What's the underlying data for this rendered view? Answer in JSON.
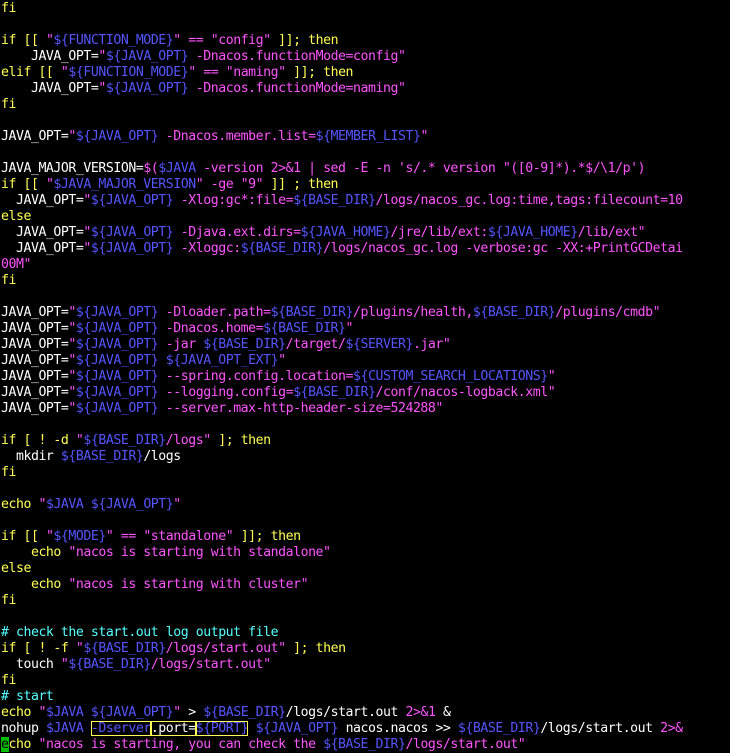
{
  "app": {
    "type": "terminal-vim",
    "theme": "dark"
  },
  "colors": {
    "background": "#000000",
    "text": "#ffffff",
    "keyword": "#ffff55",
    "string": "#ff55ff",
    "variable": "#5555ff",
    "comment": "#55ffff",
    "cursor": "#00c000"
  },
  "lines": [
    [
      {
        "t": "fi",
        "c": "k"
      }
    ],
    [],
    [
      {
        "t": "if [[ ",
        "c": "k"
      },
      {
        "t": "\"",
        "c": "s"
      },
      {
        "t": "${FUNCTION_MODE}",
        "c": "v"
      },
      {
        "t": "\" == \"config\"",
        "c": "s"
      },
      {
        "t": " ]]; then",
        "c": "k"
      }
    ],
    [
      {
        "t": "    JAVA_OPT=",
        "c": "w"
      },
      {
        "t": "\"",
        "c": "s"
      },
      {
        "t": "${JAVA_OPT}",
        "c": "v"
      },
      {
        "t": " -Dnacos.functionMode=config\"",
        "c": "s"
      }
    ],
    [
      {
        "t": "elif [[ ",
        "c": "k"
      },
      {
        "t": "\"",
        "c": "s"
      },
      {
        "t": "${FUNCTION_MODE}",
        "c": "v"
      },
      {
        "t": "\" == \"naming\"",
        "c": "s"
      },
      {
        "t": " ]]; then",
        "c": "k"
      }
    ],
    [
      {
        "t": "    JAVA_OPT=",
        "c": "w"
      },
      {
        "t": "\"",
        "c": "s"
      },
      {
        "t": "${JAVA_OPT}",
        "c": "v"
      },
      {
        "t": " -Dnacos.functionMode=naming\"",
        "c": "s"
      }
    ],
    [
      {
        "t": "fi",
        "c": "k"
      }
    ],
    [],
    [
      {
        "t": "JAVA_OPT=",
        "c": "w"
      },
      {
        "t": "\"",
        "c": "s"
      },
      {
        "t": "${JAVA_OPT}",
        "c": "v"
      },
      {
        "t": " -Dnacos.member.list=",
        "c": "s"
      },
      {
        "t": "${MEMBER_LIST}",
        "c": "v"
      },
      {
        "t": "\"",
        "c": "s"
      }
    ],
    [],
    [
      {
        "t": "JAVA_MAJOR_VERSION=",
        "c": "w"
      },
      {
        "t": "$(",
        "c": "s"
      },
      {
        "t": "$JAVA",
        "c": "v"
      },
      {
        "t": " -version 2>&1 | sed -E -n 's/.* version \"([0-9]*).*$/\\1/p')",
        "c": "s"
      }
    ],
    [
      {
        "t": "if [[ ",
        "c": "k"
      },
      {
        "t": "\"",
        "c": "s"
      },
      {
        "t": "$JAVA_MAJOR_VERSION",
        "c": "v"
      },
      {
        "t": "\" -ge \"9\"",
        "c": "s"
      },
      {
        "t": " ]] ; then",
        "c": "k"
      }
    ],
    [
      {
        "t": "  JAVA_OPT=",
        "c": "w"
      },
      {
        "t": "\"",
        "c": "s"
      },
      {
        "t": "${JAVA_OPT}",
        "c": "v"
      },
      {
        "t": " -Xlog:gc*:file=",
        "c": "s"
      },
      {
        "t": "${BASE_DIR}",
        "c": "v"
      },
      {
        "t": "/logs/nacos_gc.log:time,tags:filecount=10",
        "c": "s"
      }
    ],
    [
      {
        "t": "else",
        "c": "k"
      }
    ],
    [
      {
        "t": "  JAVA_OPT=",
        "c": "w"
      },
      {
        "t": "\"",
        "c": "s"
      },
      {
        "t": "${JAVA_OPT}",
        "c": "v"
      },
      {
        "t": " -Djava.ext.dirs=",
        "c": "s"
      },
      {
        "t": "${JAVA_HOME}",
        "c": "v"
      },
      {
        "t": "/jre/lib/ext:",
        "c": "s"
      },
      {
        "t": "${JAVA_HOME}",
        "c": "v"
      },
      {
        "t": "/lib/ext\"",
        "c": "s"
      }
    ],
    [
      {
        "t": "  JAVA_OPT=",
        "c": "w"
      },
      {
        "t": "\"",
        "c": "s"
      },
      {
        "t": "${JAVA_OPT}",
        "c": "v"
      },
      {
        "t": " -Xloggc:",
        "c": "s"
      },
      {
        "t": "${BASE_DIR}",
        "c": "v"
      },
      {
        "t": "/logs/nacos_gc.log -verbose:gc -XX:+PrintGCDetai",
        "c": "s"
      }
    ],
    [
      {
        "t": "00M\"",
        "c": "s"
      }
    ],
    [
      {
        "t": "fi",
        "c": "k"
      }
    ],
    [],
    [
      {
        "t": "JAVA_OPT=",
        "c": "w"
      },
      {
        "t": "\"",
        "c": "s"
      },
      {
        "t": "${JAVA_OPT}",
        "c": "v"
      },
      {
        "t": " -Dloader.path=",
        "c": "s"
      },
      {
        "t": "${BASE_DIR}",
        "c": "v"
      },
      {
        "t": "/plugins/health,",
        "c": "s"
      },
      {
        "t": "${BASE_DIR}",
        "c": "v"
      },
      {
        "t": "/plugins/cmdb\"",
        "c": "s"
      }
    ],
    [
      {
        "t": "JAVA_OPT=",
        "c": "w"
      },
      {
        "t": "\"",
        "c": "s"
      },
      {
        "t": "${JAVA_OPT}",
        "c": "v"
      },
      {
        "t": " -Dnacos.home=",
        "c": "s"
      },
      {
        "t": "${BASE_DIR}",
        "c": "v"
      },
      {
        "t": "\"",
        "c": "s"
      }
    ],
    [
      {
        "t": "JAVA_OPT=",
        "c": "w"
      },
      {
        "t": "\"",
        "c": "s"
      },
      {
        "t": "${JAVA_OPT}",
        "c": "v"
      },
      {
        "t": " -jar ",
        "c": "s"
      },
      {
        "t": "${BASE_DIR}",
        "c": "v"
      },
      {
        "t": "/target/",
        "c": "s"
      },
      {
        "t": "${SERVER}",
        "c": "v"
      },
      {
        "t": ".jar\"",
        "c": "s"
      }
    ],
    [
      {
        "t": "JAVA_OPT=",
        "c": "w"
      },
      {
        "t": "\"",
        "c": "s"
      },
      {
        "t": "${JAVA_OPT}",
        "c": "v"
      },
      {
        "t": " ",
        "c": "s"
      },
      {
        "t": "${JAVA_OPT_EXT}",
        "c": "v"
      },
      {
        "t": "\"",
        "c": "s"
      }
    ],
    [
      {
        "t": "JAVA_OPT=",
        "c": "w"
      },
      {
        "t": "\"",
        "c": "s"
      },
      {
        "t": "${JAVA_OPT}",
        "c": "v"
      },
      {
        "t": " --spring.config.location=",
        "c": "s"
      },
      {
        "t": "${CUSTOM_SEARCH_LOCATIONS}",
        "c": "v"
      },
      {
        "t": "\"",
        "c": "s"
      }
    ],
    [
      {
        "t": "JAVA_OPT=",
        "c": "w"
      },
      {
        "t": "\"",
        "c": "s"
      },
      {
        "t": "${JAVA_OPT}",
        "c": "v"
      },
      {
        "t": " --logging.config=",
        "c": "s"
      },
      {
        "t": "${BASE_DIR}",
        "c": "v"
      },
      {
        "t": "/conf/nacos-logback.xml\"",
        "c": "s"
      }
    ],
    [
      {
        "t": "JAVA_OPT=",
        "c": "w"
      },
      {
        "t": "\"",
        "c": "s"
      },
      {
        "t": "${JAVA_OPT}",
        "c": "v"
      },
      {
        "t": " --server.max-http-header-size=524288\"",
        "c": "s"
      }
    ],
    [],
    [
      {
        "t": "if [ ! -d ",
        "c": "k"
      },
      {
        "t": "\"",
        "c": "s"
      },
      {
        "t": "${BASE_DIR}",
        "c": "v"
      },
      {
        "t": "/logs\"",
        "c": "s"
      },
      {
        "t": " ]; then",
        "c": "k"
      }
    ],
    [
      {
        "t": "  mkdir ",
        "c": "w"
      },
      {
        "t": "${BASE_DIR}",
        "c": "v"
      },
      {
        "t": "/logs",
        "c": "w"
      }
    ],
    [
      {
        "t": "fi",
        "c": "k"
      }
    ],
    [],
    [
      {
        "t": "echo ",
        "c": "k"
      },
      {
        "t": "\"",
        "c": "s"
      },
      {
        "t": "$JAVA ${JAVA_OPT}",
        "c": "v"
      },
      {
        "t": "\"",
        "c": "s"
      }
    ],
    [],
    [
      {
        "t": "if [[ ",
        "c": "k"
      },
      {
        "t": "\"",
        "c": "s"
      },
      {
        "t": "${MODE}",
        "c": "v"
      },
      {
        "t": "\" == \"standalone\"",
        "c": "s"
      },
      {
        "t": " ]]; then",
        "c": "k"
      }
    ],
    [
      {
        "t": "    echo ",
        "c": "k"
      },
      {
        "t": "\"nacos is starting with standalone\"",
        "c": "s"
      }
    ],
    [
      {
        "t": "else",
        "c": "k"
      }
    ],
    [
      {
        "t": "    echo ",
        "c": "k"
      },
      {
        "t": "\"nacos is starting with cluster\"",
        "c": "s"
      }
    ],
    [
      {
        "t": "fi",
        "c": "k"
      }
    ],
    [],
    [
      {
        "t": "# check the start.out log output file",
        "c": "c"
      }
    ],
    [
      {
        "t": "if [ ! -f ",
        "c": "k"
      },
      {
        "t": "\"",
        "c": "s"
      },
      {
        "t": "${BASE_DIR}",
        "c": "v"
      },
      {
        "t": "/logs/start.out\"",
        "c": "s"
      },
      {
        "t": " ]; then",
        "c": "k"
      }
    ],
    [
      {
        "t": "  touch ",
        "c": "w"
      },
      {
        "t": "\"",
        "c": "s"
      },
      {
        "t": "${BASE_DIR}",
        "c": "v"
      },
      {
        "t": "/logs/start.out\"",
        "c": "s"
      }
    ],
    [
      {
        "t": "fi",
        "c": "k"
      }
    ],
    [
      {
        "t": "# start",
        "c": "c"
      }
    ],
    [
      {
        "t": "echo ",
        "c": "k"
      },
      {
        "t": "\"",
        "c": "s"
      },
      {
        "t": "$JAVA ${JAVA_OPT}",
        "c": "v"
      },
      {
        "t": "\"",
        "c": "s"
      },
      {
        "t": " > ",
        "c": "w"
      },
      {
        "t": "${BASE_DIR}",
        "c": "v"
      },
      {
        "t": "/logs/start.out ",
        "c": "w"
      },
      {
        "t": "2>&1",
        "c": "s"
      },
      {
        "t": " &",
        "c": "w"
      }
    ],
    [
      {
        "t": "nohup ",
        "c": "w"
      },
      {
        "t": "$JAVA",
        "c": "v"
      },
      {
        "t": " ",
        "c": "w"
      },
      {
        "t": "-Dserver",
        "c": "v",
        "box": true
      },
      {
        "t": ".port=",
        "c": "w",
        "box": true
      },
      {
        "t": "${PORT}",
        "c": "v",
        "box": true
      },
      {
        "t": " ",
        "c": "w"
      },
      {
        "t": "${JAVA_OPT}",
        "c": "v"
      },
      {
        "t": " nacos.nacos >> ",
        "c": "w"
      },
      {
        "t": "${BASE_DIR}",
        "c": "v"
      },
      {
        "t": "/logs/start.out ",
        "c": "w"
      },
      {
        "t": "2>&",
        "c": "s"
      }
    ],
    [
      {
        "t": "e",
        "c": "w",
        "cursor": true
      },
      {
        "t": "cho ",
        "c": "k"
      },
      {
        "t": "\"nacos is starting, you can check the ",
        "c": "s"
      },
      {
        "t": "${BASE_DIR}",
        "c": "v"
      },
      {
        "t": "/logs/start.out\"",
        "c": "s"
      }
    ]
  ]
}
